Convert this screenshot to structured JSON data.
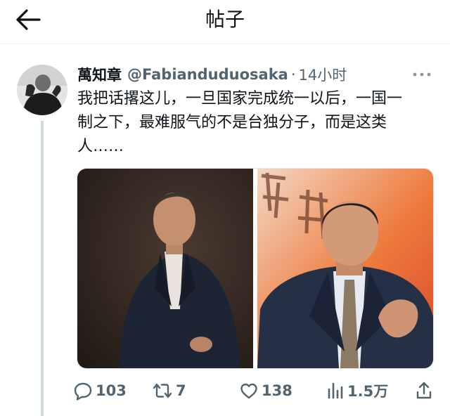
{
  "header": {
    "back_icon": "arrow-left-icon",
    "title": "帖子"
  },
  "tweet": {
    "display_name": "萬知章",
    "handle": "@Fabianduduosaka",
    "separator": "·",
    "time": "14小时",
    "more_icon": "more-horizontal-icon",
    "text": "我把话撂这儿，一旦国家完成统一以后，一国一\n制之下，最难服气的不是台独分子，而是这类\n人……",
    "media_count": 2
  },
  "actions": {
    "reply": {
      "icon": "reply-icon",
      "count": "103"
    },
    "retweet": {
      "icon": "retweet-icon",
      "count": "7"
    },
    "like": {
      "icon": "heart-icon",
      "count": "138"
    },
    "views": {
      "icon": "views-bar-chart-icon",
      "count": "1.5万"
    },
    "share": {
      "icon": "share-icon"
    }
  },
  "colors": {
    "primary_text": "#0f1419",
    "secondary_text": "#536471",
    "thread_line": "#cfd9de",
    "right_photo_bg": "#e8612c"
  }
}
